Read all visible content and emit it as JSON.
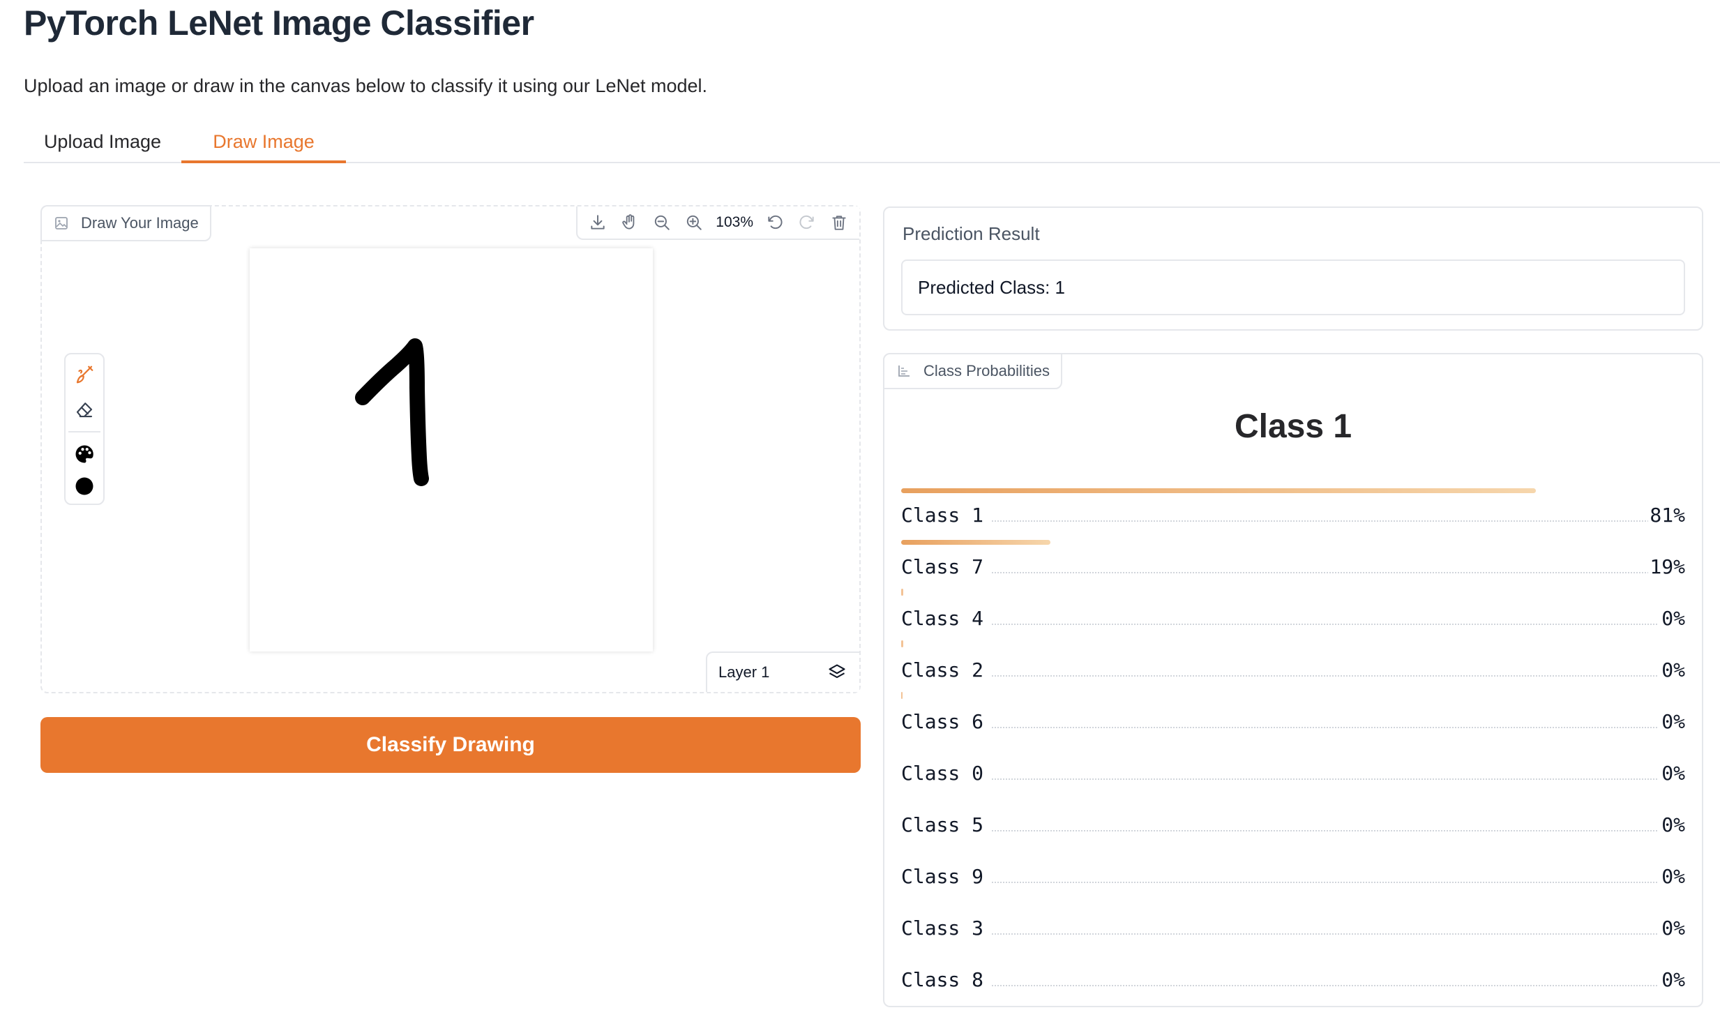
{
  "title": "PyTorch LeNet Image Classifier",
  "subtitle": "Upload an image or draw in the canvas below to classify it using our LeNet model.",
  "tabs": [
    {
      "label": "Upload Image",
      "selected": false
    },
    {
      "label": "Draw Image",
      "selected": true
    }
  ],
  "draw": {
    "label": "Draw Your Image",
    "zoom": "103%",
    "layer": "Layer 1",
    "toolbar_icons": [
      "download-icon",
      "pan-hand-icon",
      "zoom-out-icon",
      "zoom-in-icon",
      "undo-icon",
      "redo-icon",
      "trash-icon"
    ],
    "tools": [
      "brush-icon",
      "eraser-icon",
      "palette-icon",
      "brush-size-dot-icon"
    ],
    "accent": "#e8772e"
  },
  "classify_button": "Classify Drawing",
  "prediction": {
    "label": "Prediction Result",
    "value": "Predicted Class: 1"
  },
  "probabilities": {
    "label": "Class Probabilities",
    "top_class": "Class 1",
    "rows": [
      {
        "name": "Class 1",
        "value": "81%",
        "fraction": 0.81
      },
      {
        "name": "Class 7",
        "value": "19%",
        "fraction": 0.19
      },
      {
        "name": "Class 4",
        "value": "0%",
        "fraction": 0.003
      },
      {
        "name": "Class 2",
        "value": "0%",
        "fraction": 0.003
      },
      {
        "name": "Class 6",
        "value": "0%",
        "fraction": 0.002
      },
      {
        "name": "Class 0",
        "value": "0%",
        "fraction": 0
      },
      {
        "name": "Class 5",
        "value": "0%",
        "fraction": 0
      },
      {
        "name": "Class 9",
        "value": "0%",
        "fraction": 0
      },
      {
        "name": "Class 3",
        "value": "0%",
        "fraction": 0
      },
      {
        "name": "Class 8",
        "value": "0%",
        "fraction": 0
      }
    ]
  }
}
